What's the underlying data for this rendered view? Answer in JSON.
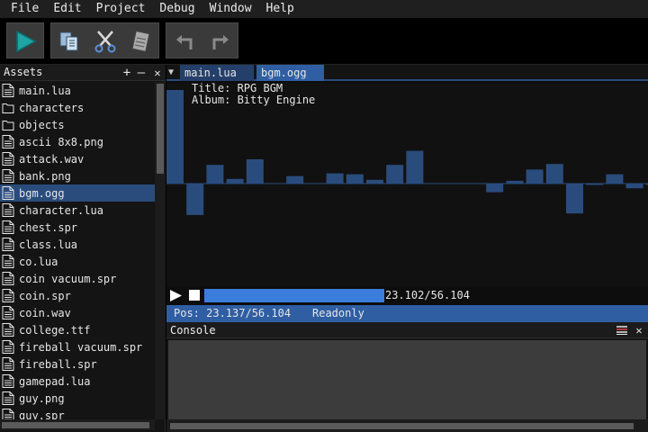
{
  "menu": [
    "File",
    "Edit",
    "Project",
    "Debug",
    "Window",
    "Help"
  ],
  "toolbar": {
    "buttons": [
      "play-icon",
      "copy-icon",
      "cut-icon",
      "paste-icon",
      "undo-icon",
      "redo-icon"
    ]
  },
  "assets": {
    "title": "Assets",
    "add": "+",
    "remove": "—",
    "close": "✕",
    "items": [
      {
        "label": "main.lua",
        "type": "file",
        "selected": false
      },
      {
        "label": "characters",
        "type": "folder",
        "selected": false
      },
      {
        "label": "objects",
        "type": "folder",
        "selected": false
      },
      {
        "label": "ascii 8x8.png",
        "type": "file",
        "selected": false
      },
      {
        "label": "attack.wav",
        "type": "file",
        "selected": false
      },
      {
        "label": "bank.png",
        "type": "file",
        "selected": false
      },
      {
        "label": "bgm.ogg",
        "type": "file",
        "selected": true
      },
      {
        "label": "character.lua",
        "type": "file",
        "selected": false
      },
      {
        "label": "chest.spr",
        "type": "file",
        "selected": false
      },
      {
        "label": "class.lua",
        "type": "file",
        "selected": false
      },
      {
        "label": "co.lua",
        "type": "file",
        "selected": false
      },
      {
        "label": "coin vacuum.spr",
        "type": "file",
        "selected": false
      },
      {
        "label": "coin.spr",
        "type": "file",
        "selected": false
      },
      {
        "label": "coin.wav",
        "type": "file",
        "selected": false
      },
      {
        "label": "college.ttf",
        "type": "file",
        "selected": false
      },
      {
        "label": "fireball vacuum.spr",
        "type": "file",
        "selected": false
      },
      {
        "label": "fireball.spr",
        "type": "file",
        "selected": false
      },
      {
        "label": "gamepad.lua",
        "type": "file",
        "selected": false
      },
      {
        "label": "guy.png",
        "type": "file",
        "selected": false
      },
      {
        "label": "guy.spr",
        "type": "file",
        "selected": false
      }
    ]
  },
  "tabs": [
    {
      "label": "main.lua",
      "active": false
    },
    {
      "label": "bgm.ogg",
      "active": true
    }
  ],
  "audio": {
    "title_line": "Title: RPG BGM",
    "album_line": "Album: Bitty Engine",
    "waveform": [
      1.0,
      -0.4,
      0.2,
      0.05,
      0.26,
      0,
      0.08,
      0,
      0.11,
      0.1,
      0.04,
      0.2,
      0.35,
      0,
      0,
      0,
      -0.11,
      0.03,
      0.15,
      0.21,
      -0.38,
      -0.01,
      0.1,
      -0.06,
      -0.01,
      -0.71
    ],
    "progress": 0.41,
    "time": "23.102/56.104"
  },
  "status": {
    "pos": "Pos: 23.137/56.104",
    "mode": "Readonly"
  },
  "console": {
    "title": "Console",
    "close": "✕"
  },
  "colors": {
    "accent": "#2f5ea3",
    "bar": "#2a4c7d",
    "progress": "#3b7ddc",
    "play": "#1fa3a3"
  }
}
